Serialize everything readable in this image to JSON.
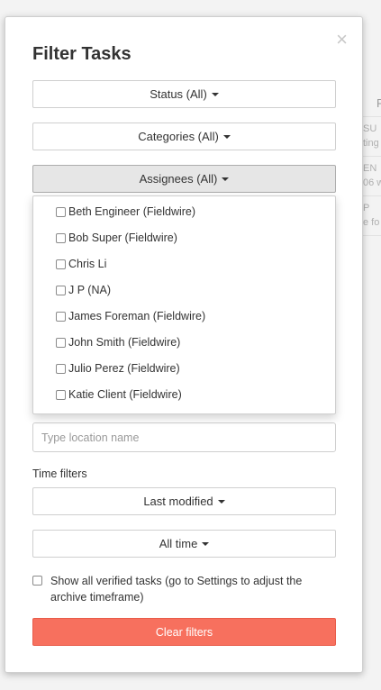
{
  "modal": {
    "title": "Filter Tasks",
    "close_glyph": "×"
  },
  "filters": {
    "status_label": "Status (All)",
    "categories_label": "Categories (All)",
    "assignees_label": "Assignees (All)"
  },
  "assignees_menu": {
    "items": [
      "Beth Engineer (Fieldwire)",
      "Bob Super (Fieldwire)",
      "Chris Li",
      "J P (NA)",
      "James Foreman (Fieldwire)",
      "John Smith (Fieldwire)",
      "Julio Perez (Fieldwire)",
      "Katie Client (Fieldwire)"
    ]
  },
  "location": {
    "placeholder": "Type location name"
  },
  "time_filters": {
    "section_label": "Time filters",
    "modified_label": "Last modified",
    "range_label": "All time"
  },
  "verified": {
    "label": "Show all verified tasks (go to Settings to adjust the archive timeframe)"
  },
  "clear_button": {
    "label": "Clear filters"
  },
  "background": {
    "header_letter": "P",
    "snippets": [
      "SU",
      "ting",
      "EN",
      "06 w",
      "P",
      "e fo"
    ]
  },
  "colors": {
    "accent_red": "#f7705e"
  }
}
